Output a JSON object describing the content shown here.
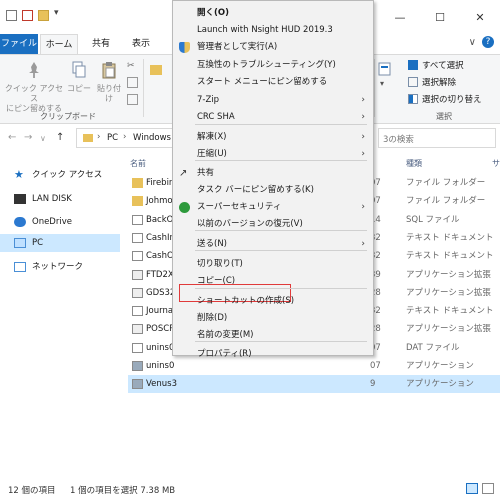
{
  "ribbon_tabs": {
    "file": "ファイル",
    "home": "ホーム",
    "share": "共有",
    "view": "表示"
  },
  "ribbon": {
    "pin_quick_access": "クイック アクセス\nにピン留めする",
    "copy": "コピー",
    "paste": "貼り付け",
    "group_clipboard": "クリップボード",
    "select_all": "すべて選択",
    "select_none": "選択解除",
    "invert_selection": "選択の切り替え",
    "group_select": "選択"
  },
  "address": {
    "path_pc": "PC",
    "path_windows": "Windows (",
    "search_placeholder": "3の検索"
  },
  "nav_pane": [
    {
      "label": "クイック アクセス",
      "icon": "star-icon"
    },
    {
      "label": "LAN DISK",
      "icon": "nas-icon"
    },
    {
      "label": "OneDrive",
      "icon": "cloud-icon"
    },
    {
      "label": "PC",
      "icon": "pc-icon"
    },
    {
      "label": "ネットワーク",
      "icon": "network-icon"
    }
  ],
  "columns": {
    "name": "名前",
    "type": "種類",
    "extra": "サ"
  },
  "files": [
    {
      "name": "Firebir",
      "date": "07",
      "type": "ファイル フォルダー",
      "icon": "folder-icon",
      "selected": false
    },
    {
      "name": "Johmo",
      "date": "07",
      "type": "ファイル フォルダー",
      "icon": "folder-icon",
      "selected": false
    },
    {
      "name": "BackO",
      "date": "14",
      "type": "SQL ファイル",
      "icon": "file-icon",
      "selected": false
    },
    {
      "name": "CashIn",
      "date": "32",
      "type": "テキスト ドキュメント",
      "icon": "file-icon",
      "selected": false
    },
    {
      "name": "CashO",
      "date": "32",
      "type": "テキスト ドキュメント",
      "icon": "file-icon",
      "selected": false
    },
    {
      "name": "FTD2X",
      "date": "39",
      "type": "アプリケーション拡張",
      "icon": "dll-icon",
      "selected": false
    },
    {
      "name": "GDS32",
      "date": "28",
      "type": "アプリケーション拡張",
      "icon": "dll-icon",
      "selected": false
    },
    {
      "name": "Journa",
      "date": "32",
      "type": "テキスト ドキュメント",
      "icon": "file-icon",
      "selected": false
    },
    {
      "name": "POSCR",
      "date": "28",
      "type": "アプリケーション拡張",
      "icon": "dll-icon",
      "selected": false
    },
    {
      "name": "unins0",
      "date": "07",
      "type": "DAT ファイル",
      "icon": "file-icon",
      "selected": false
    },
    {
      "name": "unins0",
      "date": "07",
      "type": "アプリケーション",
      "icon": "app-icon",
      "selected": false
    },
    {
      "name": "Venus3",
      "date": "9",
      "type": "アプリケーション",
      "icon": "app-icon",
      "selected": true
    }
  ],
  "status": {
    "count": "12 個の項目",
    "selection": "1 個の項目を選択  7.38 MB"
  },
  "context_menu": [
    {
      "label": "開く(O)",
      "bold": true
    },
    {
      "label": "Launch with Nsight HUD 2019.3"
    },
    {
      "label": "管理者として実行(A)",
      "icon": "shield-icon"
    },
    {
      "label": "互換性のトラブルシューティング(Y)"
    },
    {
      "label": "スタート メニューにピン留めする"
    },
    {
      "label": "7-Zip",
      "submenu": true
    },
    {
      "label": "CRC SHA",
      "submenu": true
    },
    {
      "label": "解凍(X)",
      "submenu": true
    },
    {
      "label": "圧縮(U)",
      "submenu": true
    },
    {
      "label": "共有",
      "icon": "share-icon"
    },
    {
      "label": "タスク バーにピン留めする(K)"
    },
    {
      "label": "スーパーセキュリティ",
      "submenu": true,
      "icon": "security-icon"
    },
    {
      "label": "以前のバージョンの復元(V)"
    },
    {
      "label": "送る(N)",
      "submenu": true
    },
    {
      "label": "切り取り(T)"
    },
    {
      "label": "コピー(C)"
    },
    {
      "label": "ショートカットの作成(S)",
      "highlighted": true
    },
    {
      "label": "削除(D)"
    },
    {
      "label": "名前の変更(M)"
    },
    {
      "label": "プロパティ(R)"
    }
  ],
  "colors": {
    "accent": "#1a6fc1",
    "selection": "#cce8ff",
    "highlight_box": "#e03a3a",
    "folder": "#e8c15a"
  }
}
